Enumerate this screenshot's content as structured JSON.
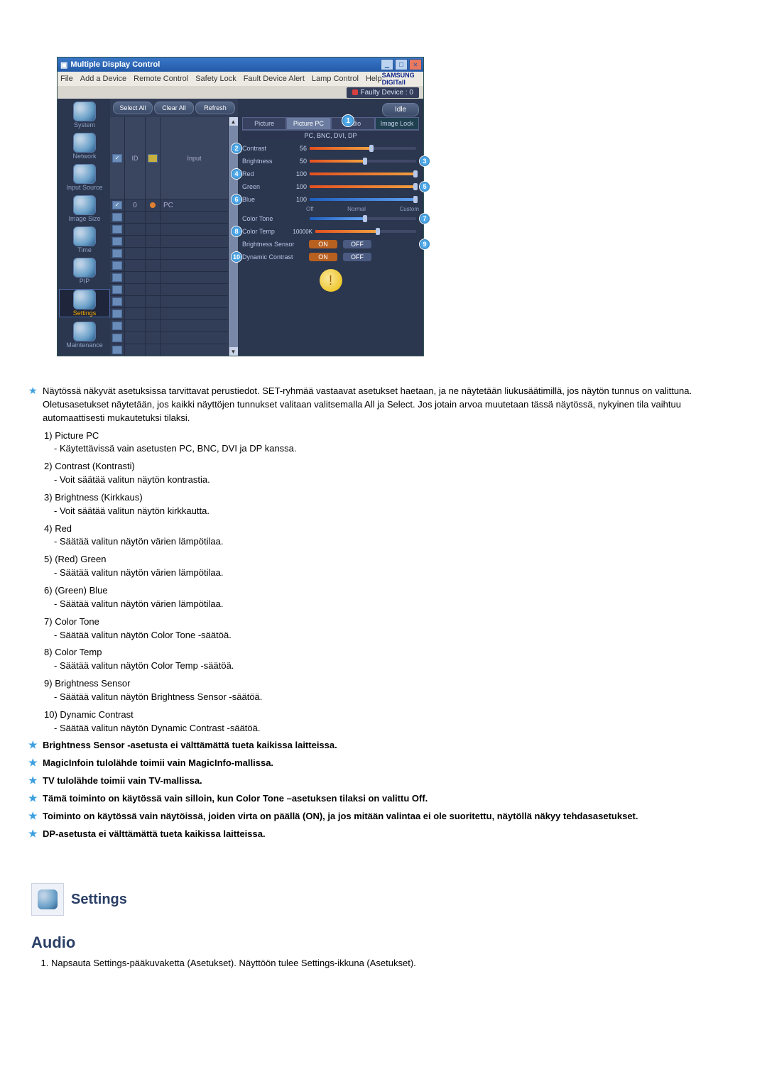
{
  "window": {
    "title": "Multiple Display Control",
    "menus": [
      "File",
      "Add a Device",
      "Remote Control",
      "Safety Lock",
      "Fault Device Alert",
      "Lamp Control",
      "Help"
    ],
    "brand": "SAMSUNG DIGITall",
    "faulty_label": "Faulty Device : 0",
    "buttons": {
      "select_all": "Select All",
      "clear_all": "Clear All",
      "refresh": "Refresh",
      "idle": "Idle"
    },
    "grid_headers": {
      "chk": "",
      "id": "ID",
      "rd": "",
      "input": "Input"
    },
    "grid_row": {
      "id": "0",
      "input": "PC"
    },
    "sidebar": [
      {
        "label": "System"
      },
      {
        "label": "Network"
      },
      {
        "label": "Input Source"
      },
      {
        "label": "Image Size"
      },
      {
        "label": "Time"
      },
      {
        "label": "PIP"
      },
      {
        "label": "Settings"
      },
      {
        "label": "Maintenance"
      }
    ],
    "tabs": [
      "Picture",
      "Picture PC",
      "Audio",
      "Image Lock"
    ],
    "panel_header": "PC, BNC, DVI, DP",
    "callouts": [
      "1",
      "2",
      "3",
      "4",
      "5",
      "6",
      "7",
      "8",
      "9",
      "10"
    ],
    "settings": {
      "contrast": {
        "label": "Contrast",
        "value": "56"
      },
      "brightness": {
        "label": "Brightness",
        "value": "50"
      },
      "red": {
        "label": "Red",
        "value": "100"
      },
      "green": {
        "label": "Green",
        "value": "100"
      },
      "blue": {
        "label": "Blue",
        "value": "100"
      },
      "color_tone": {
        "label": "Color Tone",
        "opts": [
          "Off",
          "Normal",
          "Custom"
        ]
      },
      "color_temp": {
        "label": "Color Temp",
        "value": "10000K"
      },
      "brightness_sensor": {
        "label": "Brightness Sensor"
      },
      "dynamic_contrast": {
        "label": "Dynamic Contrast"
      },
      "on": "ON",
      "off": "OFF"
    }
  },
  "doc": {
    "intro": "Näytössä näkyvät asetuksissa tarvittavat perustiedot. SET-ryhmää vastaavat asetukset haetaan, ja ne näytetään liukusäätimillä, jos näytön tunnus on valittuna. Oletusasetukset näytetään, jos kaikki näyttöjen tunnukset valitaan valitsemalla All ja Select. Jos jotain arvoa muutetaan tässä näytössä, nykyinen tila vaihtuu automaattisesti mukautetuksi tilaksi.",
    "items": [
      {
        "n": "1)",
        "t": "Picture PC",
        "b": "- Käytettävissä vain asetusten PC, BNC, DVI ja DP kanssa."
      },
      {
        "n": "2)",
        "t": "Contrast (Kontrasti)",
        "b": "- Voit säätää valitun näytön kontrastia."
      },
      {
        "n": "3)",
        "t": "Brightness (Kirkkaus)",
        "b": "- Voit säätää valitun näytön kirkkautta."
      },
      {
        "n": "4)",
        "t": "Red",
        "b": "- Säätää valitun näytön värien lämpötilaa."
      },
      {
        "n": "5)",
        "t": "(Red) Green",
        "b": "- Säätää valitun näytön värien lämpötilaa."
      },
      {
        "n": "6)",
        "t": "(Green) Blue",
        "b": "- Säätää valitun näytön värien lämpötilaa."
      },
      {
        "n": "7)",
        "t": "Color Tone",
        "b": "- Säätää valitun näytön Color Tone -säätöä."
      },
      {
        "n": "8)",
        "t": "Color Temp",
        "b": "- Säätää valitun näytön Color Temp -säätöä."
      },
      {
        "n": "9)",
        "t": "Brightness Sensor",
        "b": "- Säätää valitun näytön Brightness Sensor -säätöä."
      },
      {
        "n": "10)",
        "t": "Dynamic Contrast",
        "b": "- Säätää valitun näytön Dynamic Contrast -säätöä."
      }
    ],
    "notes": [
      "Brightness Sensor -asetusta ei välttämättä tueta kaikissa laitteissa.",
      "MagicInfoin tulolähde toimii vain MagicInfo-mallissa.",
      "TV tulolähde toimii vain TV-mallissa.",
      "Tämä toiminto on käytössä vain silloin, kun Color Tone –asetuksen tilaksi on valittu Off.",
      "Toiminto on käytössä vain näytöissä, joiden virta on päällä (ON), ja jos mitään valintaa ei ole suoritettu, näytöllä näkyy tehdasasetukset.",
      "DP-asetusta ei välttämättä tueta kaikissa laitteissa."
    ],
    "section_title": "Settings",
    "audio_heading": "Audio",
    "audio_step": "Napsauta Settings-pääkuvaketta (Asetukset). Näyttöön tulee Settings-ikkuna (Asetukset)."
  }
}
